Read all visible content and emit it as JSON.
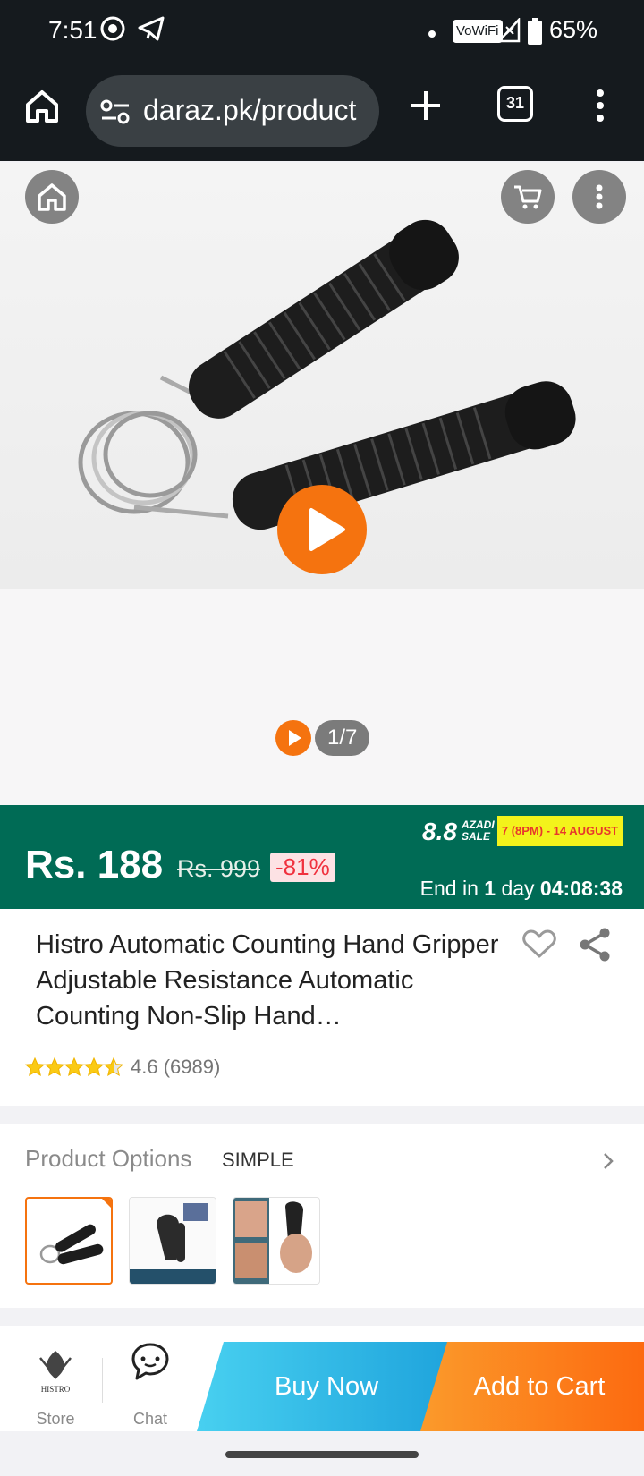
{
  "status_bar": {
    "time": "7:51",
    "wifi_label": "VoWiFi",
    "battery": "65%"
  },
  "browser": {
    "url": "daraz.pk/product",
    "tab_count": "31"
  },
  "gallery": {
    "counter": "1/7"
  },
  "price_bar": {
    "price": "Rs. 188",
    "original_price": "Rs. 999",
    "discount": "-81%",
    "sale_logo": "8.8",
    "sale_sub": "AZADI SALE",
    "sale_dates": "7 (8PM) - 14 AUGUST",
    "end_prefix": "End in",
    "end_days": "1",
    "end_day_word": "day",
    "end_time": "04:08:38"
  },
  "product": {
    "title": "Histro Automatic Counting Hand Gripper Adjustable Resistance Automatic Counting Non-Slip Hand…",
    "rating": "4.6",
    "reviews": "(6989)",
    "stars_filled": 4.5
  },
  "options": {
    "label": "Product Options",
    "value": "SIMPLE"
  },
  "bottom_bar": {
    "store_brand": "HISTRO",
    "store_label": "Store",
    "chat_label": "Chat",
    "buy_now": "Buy Now",
    "add_to_cart": "Add to Cart"
  },
  "colors": {
    "accent": "#f5730f",
    "price_bar": "#006b55",
    "buy_now": "#1ea3dc",
    "add_to_cart": "#fc6a10"
  }
}
